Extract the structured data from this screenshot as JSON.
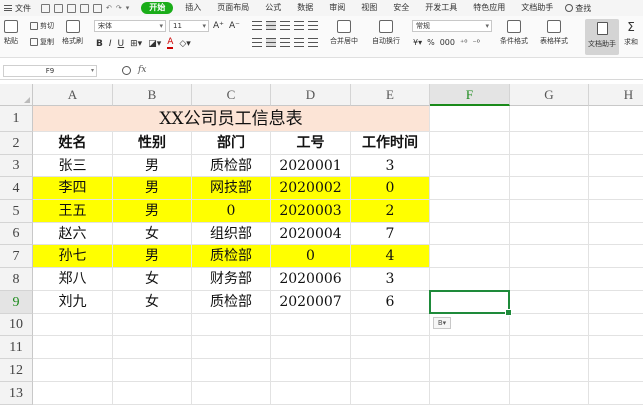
{
  "menu": {
    "file_label": "文件",
    "tabs": [
      "开始",
      "插入",
      "页面布局",
      "公式",
      "数据",
      "审阅",
      "视图",
      "安全",
      "开发工具",
      "特色应用",
      "文档助手"
    ],
    "active_tab": "开始",
    "search_label": "查找"
  },
  "ribbon": {
    "paste_label": "粘贴",
    "cut_label": "剪切",
    "copy_label": "复制",
    "format_painter_label": "格式刷",
    "font_name": "宋体",
    "font_size": "11",
    "bold": "B",
    "italic": "I",
    "underline": "U",
    "font_color": "A",
    "merge_label": "合并居中",
    "wrap_label": "自动换行",
    "number_format": "常规",
    "percent": "%",
    "thousands": "000",
    "cond_format_label": "条件格式",
    "table_style_label": "表格样式",
    "doc_assistant_label": "文档助手",
    "sum_label": "求和"
  },
  "formula_bar": {
    "name_box": "F9",
    "fx": "fx",
    "value": ""
  },
  "sheet": {
    "columns": [
      "A",
      "B",
      "C",
      "D",
      "E",
      "F",
      "G",
      "H"
    ],
    "active_column": "F",
    "rows": [
      "1",
      "2",
      "3",
      "4",
      "5",
      "6",
      "7",
      "8",
      "9",
      "10",
      "11",
      "12",
      "13"
    ],
    "active_row": "9",
    "title": "XX公司员工信息表",
    "headers": [
      "姓名",
      "性别",
      "部门",
      "工号",
      "工作时间"
    ],
    "records": [
      {
        "cells": [
          "张三",
          "男",
          "质检部",
          "2020001",
          "3"
        ],
        "highlight": false
      },
      {
        "cells": [
          "李四",
          "男",
          "网技部",
          "2020002",
          "0"
        ],
        "highlight": true
      },
      {
        "cells": [
          "王五",
          "男",
          "0",
          "2020003",
          "2"
        ],
        "highlight": true
      },
      {
        "cells": [
          "赵六",
          "女",
          "组织部",
          "2020004",
          "7"
        ],
        "highlight": false
      },
      {
        "cells": [
          "孙七",
          "男",
          "质检部",
          "0",
          "4"
        ],
        "highlight": true
      },
      {
        "cells": [
          "郑八",
          "女",
          "财务部",
          "2020006",
          "3"
        ],
        "highlight": false
      },
      {
        "cells": [
          "刘九",
          "女",
          "质检部",
          "2020007",
          "6"
        ],
        "highlight": false
      }
    ],
    "highlight_color": "#ffff00",
    "title_fill": "#fce4d6",
    "selection_color": "#1e8a3a",
    "paste_options_label": "B"
  }
}
